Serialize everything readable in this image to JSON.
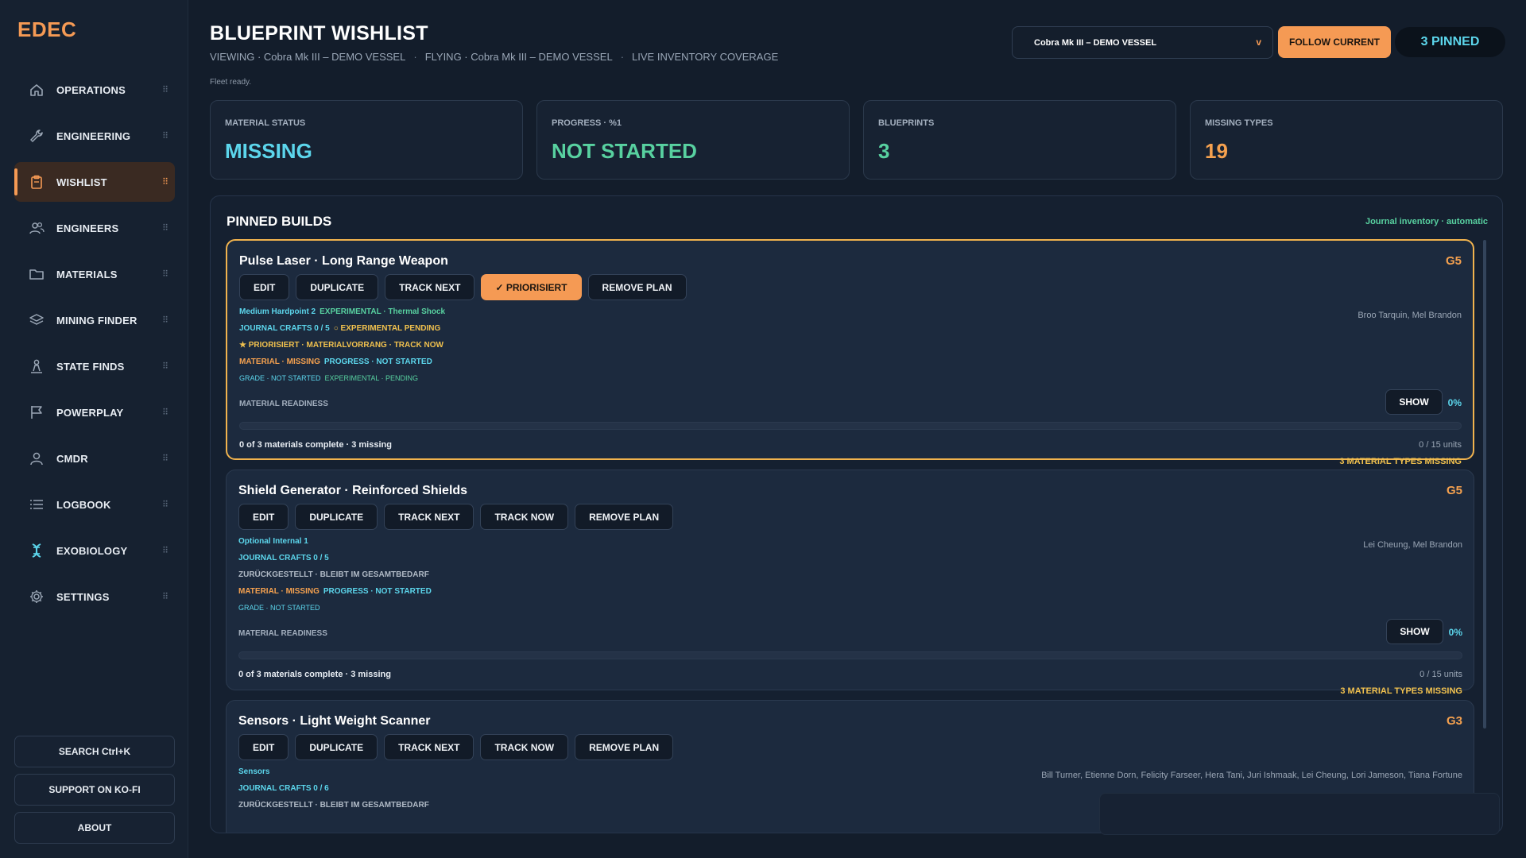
{
  "app": {
    "logo": "EDEC"
  },
  "sidebar": {
    "items": [
      {
        "label": "OPERATIONS",
        "icon": "home-icon",
        "active": false
      },
      {
        "label": "ENGINEERING",
        "icon": "wrench-icon",
        "active": false
      },
      {
        "label": "WISHLIST",
        "icon": "clipboard-icon",
        "active": true
      },
      {
        "label": "ENGINEERS",
        "icon": "users-icon",
        "active": false
      },
      {
        "label": "MATERIALS",
        "icon": "folder-icon",
        "active": false
      },
      {
        "label": "MINING FINDER",
        "icon": "layers-icon",
        "active": false
      },
      {
        "label": "STATE FINDS",
        "icon": "person-pin-icon",
        "active": false
      },
      {
        "label": "POWERPLAY",
        "icon": "flag-icon",
        "active": false
      },
      {
        "label": "CMDR",
        "icon": "user-icon",
        "active": false
      },
      {
        "label": "LOGBOOK",
        "icon": "list-icon",
        "active": false
      },
      {
        "label": "EXOBIOLOGY",
        "icon": "dna-icon",
        "active": false
      },
      {
        "label": "SETTINGS",
        "icon": "gear-icon",
        "active": false
      }
    ],
    "grip": "⠿",
    "search_label": "SEARCH  Ctrl+K",
    "support_label": "SUPPORT ON KO-FI",
    "about_label": "ABOUT"
  },
  "header": {
    "title": "BLUEPRINT WISHLIST",
    "viewing": "VIEWING · Cobra Mk III – DEMO VESSEL",
    "flying": "FLYING · Cobra Mk III – DEMO VESSEL",
    "coverage": "LIVE INVENTORY COVERAGE",
    "separator": "·",
    "status": "Fleet ready.",
    "vessel_select": "Cobra Mk III – DEMO VESSEL",
    "select_chevron": "v",
    "follow_label": "FOLLOW CURRENT",
    "pinned_label": "3 PINNED"
  },
  "stats": [
    {
      "label": "MATERIAL STATUS",
      "value": "MISSING",
      "color": "#5cd6ec"
    },
    {
      "label": "PROGRESS · %1",
      "value": "NOT STARTED",
      "color": "#58d1a0"
    },
    {
      "label": "BLUEPRINTS",
      "value": "3",
      "color": "#58d1a0"
    },
    {
      "label": "MISSING TYPES",
      "value": "19",
      "color": "#f5a14f"
    }
  ],
  "pinned": {
    "title": "PINNED BUILDS",
    "note": "Journal inventory · automatic",
    "builds": [
      {
        "name": "Pulse Laser · Long Range Weapon",
        "grade": "G5",
        "highlight": true,
        "buttons": [
          {
            "label": "EDIT",
            "prio": false
          },
          {
            "label": "DUPLICATE",
            "prio": false
          },
          {
            "label": "TRACK NEXT",
            "prio": false
          },
          {
            "label": "✓ PRIORISIERT",
            "prio": true
          },
          {
            "label": "REMOVE PLAN",
            "prio": false
          }
        ],
        "slot": "Medium Hardpoint 2",
        "experimental": "EXPERIMENTAL · Thermal Shock",
        "engineers": "Broo Tarquin, Mel Brandon",
        "journal_crafts": "JOURNAL CRAFTS   0 / 5",
        "experimental_pending": "○ EXPERIMENTAL PENDING",
        "priority_line": "★ PRIORISIERT · MATERIALVORRANG · TRACK NOW",
        "priority_color": "#f1c14e",
        "material_status": "MATERIAL · MISSING",
        "progress_status": "PROGRESS · NOT STARTED",
        "grade_status": "GRADE · NOT STARTED",
        "experimental_status": "EXPERIMENTAL · PENDING",
        "readiness_label": "MATERIAL READINESS",
        "show_label": "SHOW",
        "percent": "0%",
        "progress": 0,
        "materials_complete": "0 of 3 materials complete · 3 missing",
        "units": "0 / 15 units",
        "missing_types": "3 MATERIAL TYPES MISSING"
      },
      {
        "name": "Shield Generator · Reinforced Shields",
        "grade": "G5",
        "highlight": false,
        "buttons": [
          {
            "label": "EDIT",
            "prio": false
          },
          {
            "label": "DUPLICATE",
            "prio": false
          },
          {
            "label": "TRACK NEXT",
            "prio": false
          },
          {
            "label": "TRACK NOW",
            "prio": false
          },
          {
            "label": "REMOVE PLAN",
            "prio": false
          }
        ],
        "slot": "Optional Internal 1",
        "experimental": "",
        "engineers": "Lei Cheung, Mel Brandon",
        "journal_crafts": "JOURNAL CRAFTS   0 / 5",
        "experimental_pending": "",
        "priority_line": "ZURÜCKGESTELLT · BLEIBT IM GESAMTBEDARF",
        "priority_color": "#b0bac6",
        "material_status": "MATERIAL · MISSING",
        "progress_status": "PROGRESS · NOT STARTED",
        "grade_status": "GRADE · NOT STARTED",
        "experimental_status": "",
        "readiness_label": "MATERIAL READINESS",
        "show_label": "SHOW",
        "percent": "0%",
        "progress": 0,
        "materials_complete": "0 of 3 materials complete · 3 missing",
        "units": "0 / 15 units",
        "missing_types": "3 MATERIAL TYPES MISSING"
      },
      {
        "name": "Sensors · Light Weight Scanner",
        "grade": "G3",
        "highlight": false,
        "buttons": [
          {
            "label": "EDIT",
            "prio": false
          },
          {
            "label": "DUPLICATE",
            "prio": false
          },
          {
            "label": "TRACK NEXT",
            "prio": false
          },
          {
            "label": "TRACK NOW",
            "prio": false
          },
          {
            "label": "REMOVE PLAN",
            "prio": false
          }
        ],
        "slot": "Sensors",
        "engineers": "Bill Turner, Etienne Dorn, Felicity Farseer, Hera Tani, Juri Ishmaak, Lei Cheung, Lori Jameson, Tiana Fortune",
        "journal_crafts": "JOURNAL CRAFTS   0 / 6",
        "priority_line": "ZURÜCKGESTELLT · BLEIBT IM GESAMTBEDARF",
        "priority_color": "#b0bac6"
      }
    ]
  }
}
